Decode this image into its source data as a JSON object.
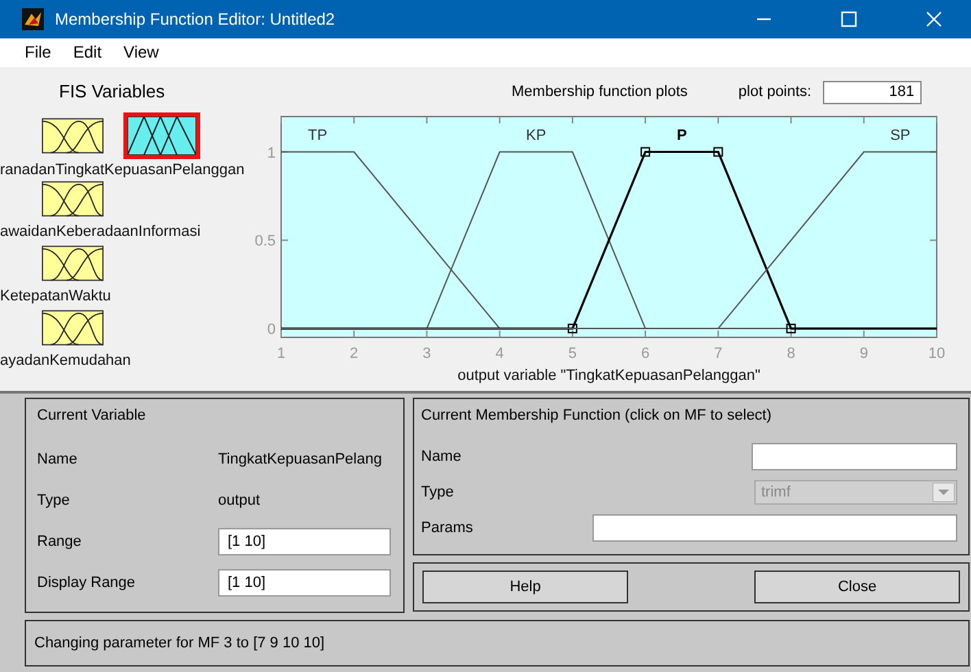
{
  "window": {
    "title": "Membership Function Editor: Untitled2"
  },
  "menu": [
    "File",
    "Edit",
    "View"
  ],
  "fis_variables": {
    "title": "FIS Variables",
    "items": [
      {
        "label": "ranadan",
        "kind": "input",
        "selected": false
      },
      {
        "label": "TingkatKepuasanPelanggan",
        "kind": "output",
        "selected": true
      },
      {
        "label": "awaidanKeberadaanInformasi",
        "kind": "input",
        "selected": false
      },
      {
        "label": "KetepatanWaktu",
        "kind": "input",
        "selected": false
      },
      {
        "label": "ayadanKemudahan",
        "kind": "input",
        "selected": false
      }
    ]
  },
  "plot": {
    "plot_points_label": "plot points:",
    "plot_points": "181",
    "chart_data": {
      "type": "line",
      "title": "Membership function plots",
      "xlabel": "output variable \"TingkatKepuasanPelanggan\"",
      "x": [
        1,
        2,
        3,
        4,
        5,
        6,
        7,
        8,
        9,
        10
      ],
      "xlim": [
        1,
        10
      ],
      "ylim": [
        -0.05,
        1.2
      ],
      "xticks": [
        1,
        2,
        3,
        4,
        5,
        6,
        7,
        8,
        9,
        10
      ],
      "yticks": [
        0,
        0.5,
        1
      ],
      "series": [
        {
          "name": "TP",
          "values": [
            1,
            1,
            0.5,
            0,
            0,
            0,
            0,
            0,
            0,
            0
          ]
        },
        {
          "name": "KP",
          "values": [
            0,
            0,
            0,
            1,
            1,
            0,
            0,
            0,
            0,
            0
          ]
        },
        {
          "name": "P",
          "values": [
            0,
            0,
            0,
            0,
            0,
            1,
            1,
            0,
            0,
            0
          ]
        },
        {
          "name": "SP",
          "values": [
            0,
            0,
            0,
            0,
            0,
            0,
            0,
            0.5,
            1,
            1
          ]
        }
      ]
    },
    "mf_states": [
      {
        "selected": false
      },
      {
        "selected": false
      },
      {
        "selected": true
      },
      {
        "selected": false
      }
    ]
  },
  "current_variable": {
    "title": "Current Variable",
    "rows": [
      {
        "label": "Name",
        "value": "TingkatKepuasanPelang",
        "kind": "text"
      },
      {
        "label": "Type",
        "value": "output",
        "kind": "text"
      },
      {
        "label": "Range",
        "value": "[1 10]",
        "kind": "field"
      },
      {
        "label": "Display Range",
        "value": "[1 10]",
        "kind": "field"
      }
    ]
  },
  "current_mf": {
    "title": "Current Membership Function (click on MF to select)",
    "name_label": "Name",
    "type_label": "Type",
    "type_value": "trimf",
    "type_disabled": true,
    "params_label": "Params"
  },
  "buttons": [
    "Help",
    "Close"
  ],
  "status": "Changing parameter for MF 3 to  [7 9 10 10]"
}
